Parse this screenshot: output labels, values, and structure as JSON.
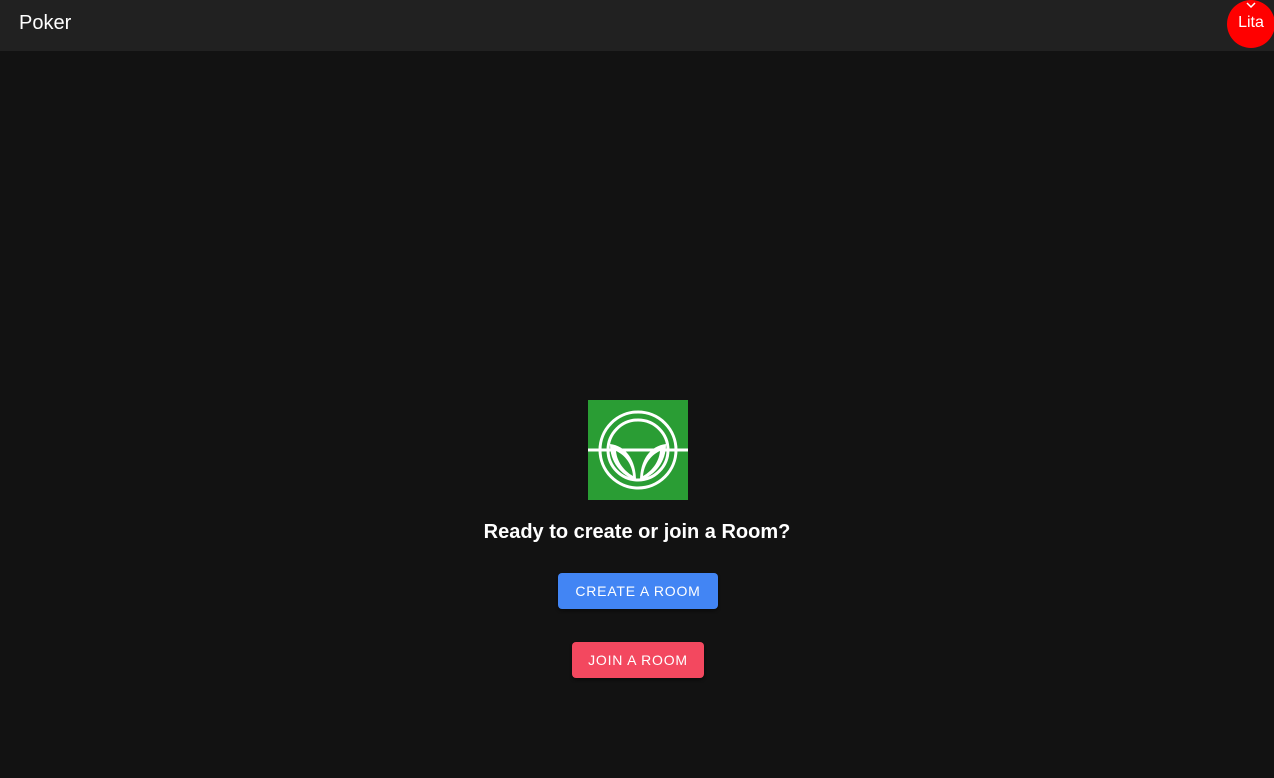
{
  "header": {
    "title": "Poker",
    "user": {
      "name": "Lita",
      "avatar_color": "#ff0000",
      "menu_icon": "chevron-down-icon"
    }
  },
  "main": {
    "logo": {
      "icon": "sprout-logo-icon",
      "background": "#2a9d34"
    },
    "prompt": "Ready to create or join a Room?",
    "create_button": {
      "label": "CREATE A ROOM",
      "color": "#4285f4"
    },
    "join_button": {
      "label": "JOIN A ROOM",
      "color": "#f3485f"
    }
  },
  "colors": {
    "background": "#121212",
    "header_background": "#212121",
    "text": "#ffffff"
  }
}
